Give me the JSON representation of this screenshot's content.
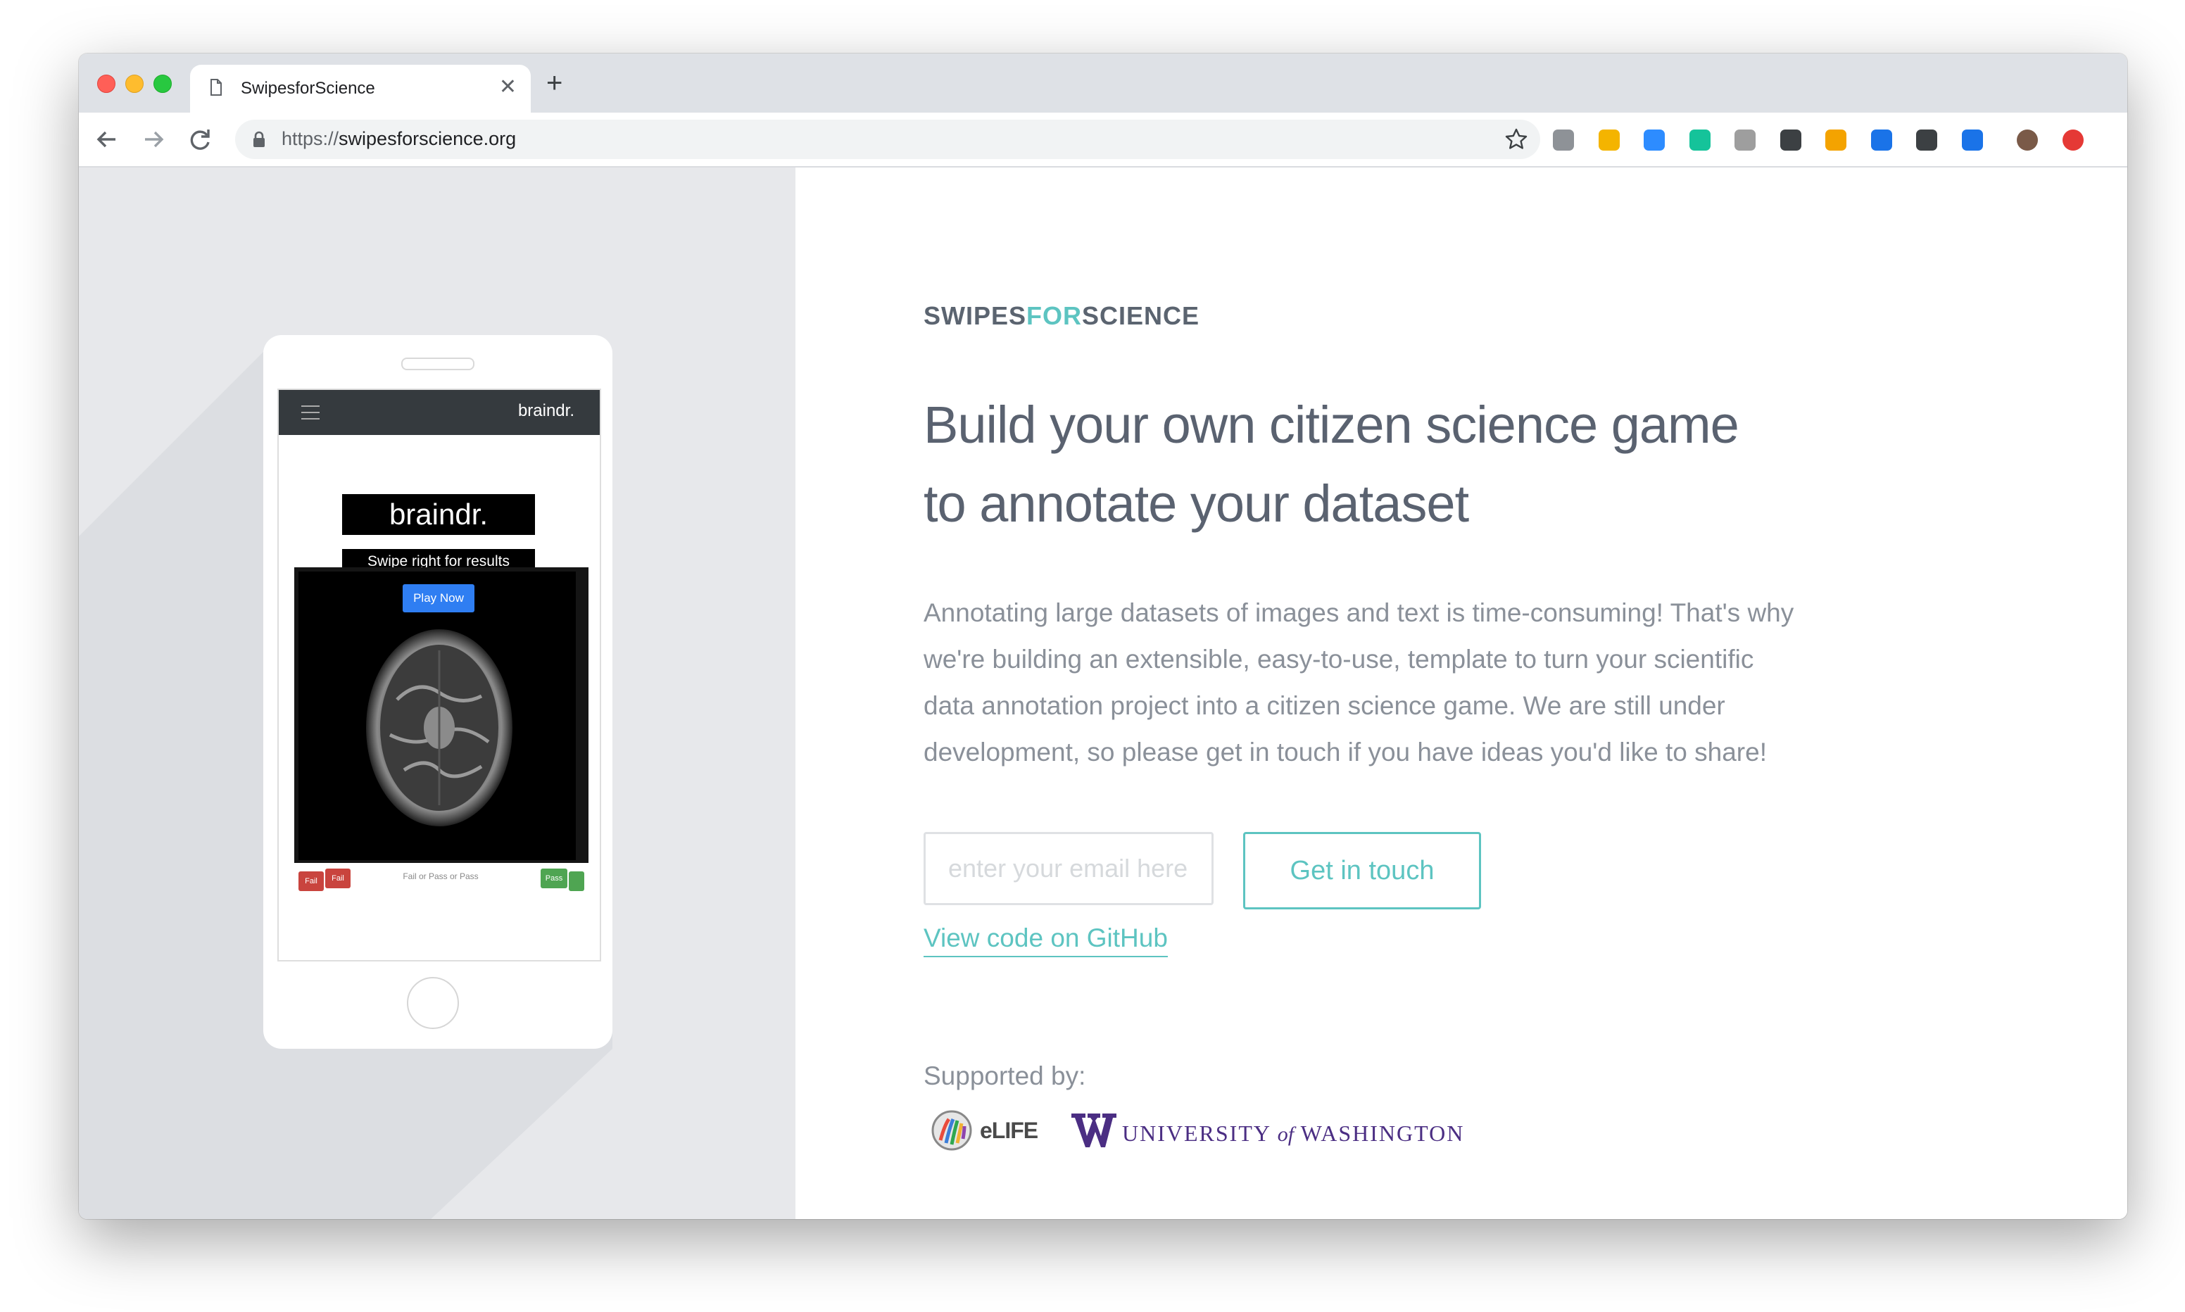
{
  "browser": {
    "tab_title": "SwipesforScience",
    "url_scheme": "https://",
    "url_host": "swipesforscience.org",
    "extensions": [
      {
        "name": "google-drive-icon",
        "color": "#8e9297"
      },
      {
        "name": "yellow-extension-icon",
        "color": "#f4b400"
      },
      {
        "name": "zoom-icon",
        "color": "#2d8cff"
      },
      {
        "name": "grammarly-icon",
        "color": "#15c39a"
      },
      {
        "name": "circle-extension-icon",
        "color": "#9e9e9e"
      },
      {
        "name": "lightbulb-extension-icon",
        "color": "#3c4043"
      },
      {
        "name": "infinity-extension-icon",
        "color": "#f4a300"
      },
      {
        "name": "graduation-cap-icon",
        "color": "#1a73e8"
      },
      {
        "name": "paypal-icon",
        "color": "#3c4043"
      },
      {
        "name": "share-arrow-icon",
        "color": "#1a73e8"
      },
      {
        "name": "profile-avatar-icon",
        "color": "#7a5a48"
      },
      {
        "name": "update-icon",
        "color": "#e53935"
      }
    ]
  },
  "phone": {
    "app_brand": "braindr.",
    "logo": "braindr.",
    "tagline": "Swipe right for results",
    "play_label": "Play Now",
    "fail_label": "Fail",
    "pass_label": "Pass",
    "swipe_hint": "Fail or Pass or Pass"
  },
  "hero": {
    "brand_a": "SWIPES",
    "brand_b": "FOR",
    "brand_c": "SCIENCE",
    "headline_1": "Build your own citizen science game",
    "headline_2": "to annotate your dataset",
    "desc_1": "Annotating large datasets of images and text is time-consuming! That's why",
    "desc_2": "we're building an extensible, easy-to-use, template to turn your scientific",
    "desc_3": "data annotation project into a citizen science game. We are still under",
    "desc_4": "development, so please get in touch if you have ideas you'd like to share!",
    "email_placeholder": "enter your email here",
    "cta_label": "Get in touch",
    "github_label": "View code on GitHub",
    "supported_label": "Supported by:",
    "elife_label": "eLIFE",
    "uw_label_a": "UNIVERSITY",
    "uw_label_of": "of",
    "uw_label_b": "WASHINGTON"
  },
  "colors": {
    "accent": "#5dc4c1",
    "uw_purple": "#4b2e83"
  }
}
